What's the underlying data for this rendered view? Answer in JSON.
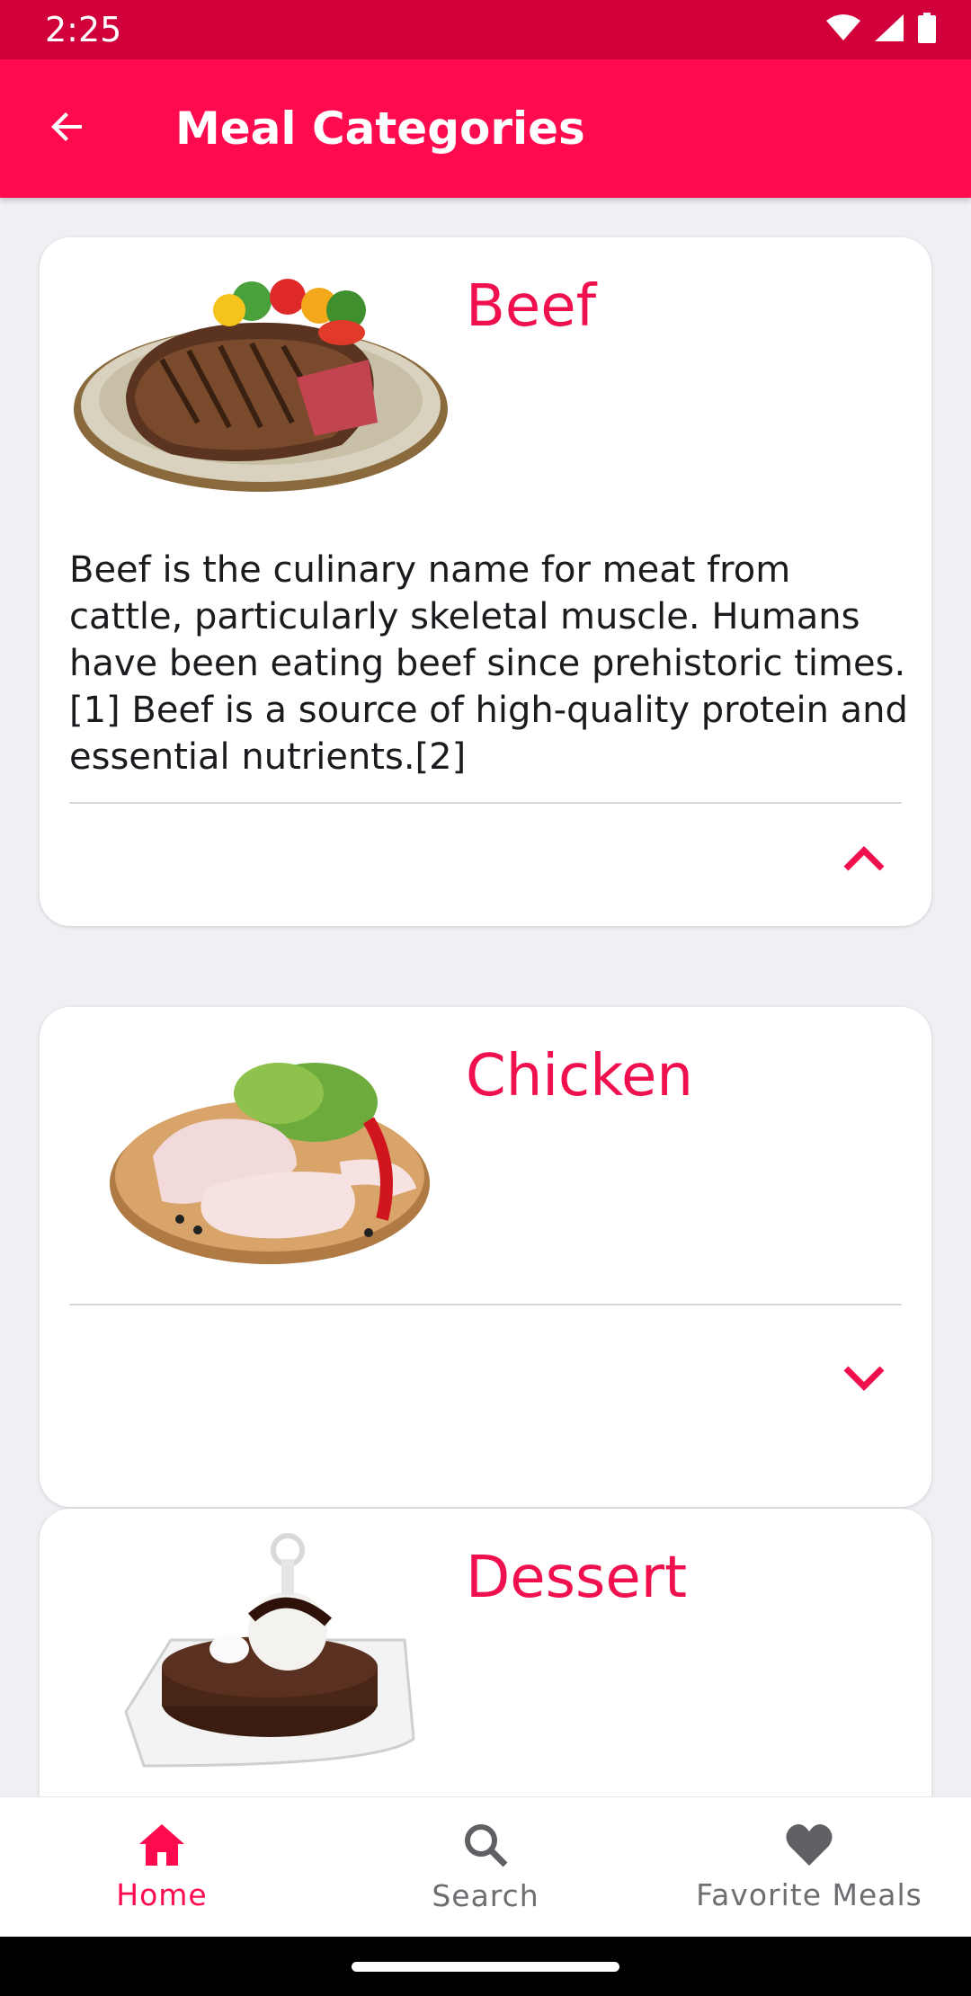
{
  "status_bar": {
    "time": "2:25",
    "icons": [
      "wifi-icon",
      "signal-icon",
      "battery-icon"
    ]
  },
  "app_bar": {
    "title": "Meal Categories",
    "back_icon": "arrow-back-icon"
  },
  "colors": {
    "accent": "#ff0a4e",
    "status_bar": "#d1003a",
    "title_text": "#f0104e"
  },
  "categories": [
    {
      "name": "Beef",
      "image": "beef-steak-image",
      "description": "Beef is the culinary name for meat from cattle, particularly skeletal muscle. Humans have been eating beef since prehistoric times.[1] Beef is a source of high-quality protein and essential nutrients.[2]",
      "expanded": true
    },
    {
      "name": "Chicken",
      "image": "chicken-legs-image",
      "expanded": false
    },
    {
      "name": "Dessert",
      "image": "chocolate-dessert-image",
      "expanded": false
    }
  ],
  "bottom_nav": {
    "items": [
      {
        "label": "Home",
        "icon": "home-icon",
        "active": true
      },
      {
        "label": "Search",
        "icon": "search-icon",
        "active": false
      },
      {
        "label": "Favorite Meals",
        "icon": "heart-icon",
        "active": false
      }
    ]
  }
}
